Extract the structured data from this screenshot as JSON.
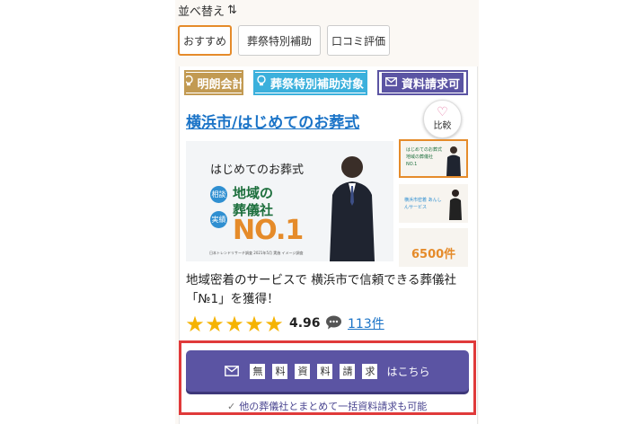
{
  "sort": {
    "label": "並べ替え",
    "icon": "sort-arrows-icon",
    "tabs": [
      {
        "label": "おすすめ",
        "active": true
      },
      {
        "label": "葬祭特別補助",
        "active": false
      },
      {
        "label": "口コミ評価",
        "active": false
      }
    ]
  },
  "badges": [
    {
      "label": "明朗会計",
      "icon": "bulb-icon",
      "color": "#c29a52"
    },
    {
      "label": "葬祭特別補助対象",
      "icon": "bulb-icon",
      "color": "#3bb0dc"
    },
    {
      "label": "資料請求可",
      "icon": "mail-icon",
      "color": "#5b54a3"
    }
  ],
  "listing": {
    "title": "横浜市/はじめてのお葬式",
    "compare_label": "比較",
    "main_image": {
      "brand": "はじめてのお葬式",
      "tag1": "相談",
      "tag2": "実績",
      "headline1": "地域の",
      "headline2": "葬儀社",
      "rank": "NO.1",
      "footnote": "日本トレンドリサーチ調査 2021年5月 実施 イメージ調査"
    },
    "thumbs": [
      {
        "text": "はじめてのお葬式 地域の葬儀社 NO.1"
      },
      {
        "text": "横浜市密着 あんしんサービス"
      },
      {
        "text": "6500件"
      }
    ],
    "description": "地域密着のサービスで 横浜市で信頼できる葬儀社「№1」を獲得！",
    "rating": "4.96",
    "rating_stars": 5,
    "review_count": "113件"
  },
  "cta": {
    "chars": [
      "無",
      "料",
      "資",
      "料",
      "請",
      "求"
    ],
    "suffix": "はこちら",
    "note": "他の葬儀社とまとめて一括資料請求も可能"
  },
  "colors": {
    "accent_orange": "#e58b2a",
    "link_blue": "#1a73c7",
    "cta_purple": "#5b54a3",
    "highlight_red": "#e03a3a",
    "star_yellow": "#f5b301"
  }
}
